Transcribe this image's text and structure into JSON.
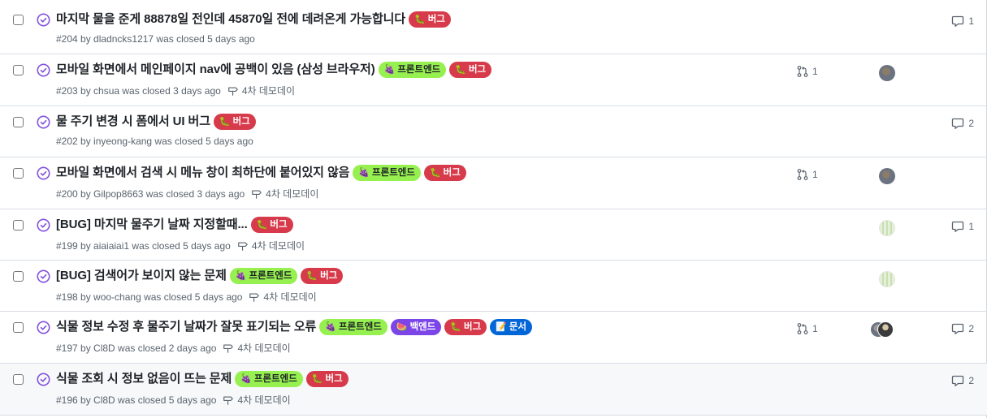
{
  "colors": {
    "closed_state": "#8250df",
    "bug": "#d73a4a",
    "frontend": "#96f04f",
    "backend": "#7b45e8",
    "docs": "#0366d6"
  },
  "issues": [
    {
      "title": "마지막 물을 준게 88878일 전인데 45870일 전에 데려온게 가능합니다",
      "labels": [
        {
          "emoji": "🐛",
          "text": "버그"
        }
      ],
      "meta": "#204 by dladncks1217 was closed 5 days ago",
      "milestone": "",
      "pr_count": "",
      "comments": "1"
    },
    {
      "title": "모바일 화면에서 메인페이지 nav에 공백이 있음 (삼성 브라우저)",
      "labels": [
        {
          "emoji": "🍇",
          "text": "프론트엔드"
        },
        {
          "emoji": "🐛",
          "text": "버그"
        }
      ],
      "meta": "#203 by chsua was closed 3 days ago",
      "milestone": "4차 데모데이",
      "pr_count": "1",
      "comments": ""
    },
    {
      "title": "물 주기 변경 시 폼에서 UI 버그",
      "labels": [
        {
          "emoji": "🐛",
          "text": "버그"
        }
      ],
      "meta": "#202 by inyeong-kang was closed 5 days ago",
      "milestone": "",
      "pr_count": "",
      "comments": "2"
    },
    {
      "title": "모바일 화면에서 검색 시 메뉴 창이 최하단에 붙어있지 않음",
      "labels": [
        {
          "emoji": "🍇",
          "text": "프론트엔드"
        },
        {
          "emoji": "🐛",
          "text": "버그"
        }
      ],
      "meta": "#200 by Gilpop8663 was closed 3 days ago",
      "milestone": "4차 데모데이",
      "pr_count": "1",
      "comments": ""
    },
    {
      "title": "[BUG] 마지막 물주기 날짜 지정할때...",
      "labels": [
        {
          "emoji": "🐛",
          "text": "버그"
        }
      ],
      "meta": "#199 by aiaiaiai1 was closed 5 days ago",
      "milestone": "4차 데모데이",
      "pr_count": "",
      "comments": "1"
    },
    {
      "title": "[BUG] 검색어가 보이지 않는 문제",
      "labels": [
        {
          "emoji": "🍇",
          "text": "프론트엔드"
        },
        {
          "emoji": "🐛",
          "text": "버그"
        }
      ],
      "meta": "#198 by woo-chang was closed 5 days ago",
      "milestone": "4차 데모데이",
      "pr_count": "",
      "comments": ""
    },
    {
      "title": "식물 정보 수정 후 물주기 날짜가 잘못 표기되는 오류",
      "labels": [
        {
          "emoji": "🍇",
          "text": "프론트엔드"
        },
        {
          "emoji": "🍉",
          "text": "백엔드"
        },
        {
          "emoji": "🐛",
          "text": "버그"
        },
        {
          "emoji": "📝",
          "text": "문서"
        }
      ],
      "meta": "#197 by Cl8D was closed 2 days ago",
      "milestone": "4차 데모데이",
      "pr_count": "1",
      "comments": "2"
    },
    {
      "title": "식물 조회 시 정보 없음이 뜨는 문제",
      "labels": [
        {
          "emoji": "🍇",
          "text": "프론트엔드"
        },
        {
          "emoji": "🐛",
          "text": "버그"
        }
      ],
      "meta": "#196 by Cl8D was closed 5 days ago",
      "milestone": "4차 데모데이",
      "pr_count": "",
      "comments": "2"
    }
  ]
}
